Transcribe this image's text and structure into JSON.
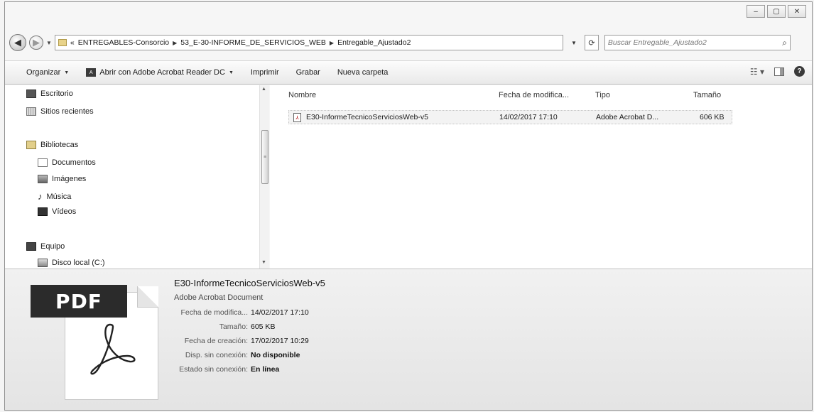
{
  "window": {
    "caption": {
      "minimize_glyph": "–",
      "maximize_glyph": "▢",
      "close_glyph": "✕"
    }
  },
  "address_bar": {
    "overflow": "«",
    "crumbs": [
      "ENTREGABLES-Consorcio",
      "53_E-30-INFORME_DE_SERVICIOS_WEB",
      "Entregable_Ajustado2"
    ],
    "separator": "▶",
    "dropdown": "▼",
    "refresh": "⟳",
    "search_placeholder": "Buscar Entregable_Ajustado2",
    "search_icon": "⌕"
  },
  "toolbar": {
    "organize": "Organizar",
    "open_with": "Abrir con Adobe Acrobat Reader DC",
    "print": "Imprimir",
    "burn": "Grabar",
    "new_folder": "Nueva carpeta",
    "view_icon": "☷",
    "help": "?"
  },
  "nav": {
    "favorites": [
      "Escritorio",
      "Sitios recientes"
    ],
    "libraries": "Bibliotecas",
    "library_items": [
      "Documentos",
      "Imágenes",
      "Música",
      "Vídeos"
    ],
    "computer": "Equipo",
    "computer_items": [
      "Disco local (C:)"
    ]
  },
  "file_list": {
    "columns": {
      "name": "Nombre",
      "modified": "Fecha de modifica...",
      "type": "Tipo",
      "size": "Tamaño"
    },
    "rows": [
      {
        "name": "E30-InformeTecnicoServiciosWeb-v5",
        "modified": "14/02/2017 17:10",
        "type": "Adobe Acrobat D...",
        "size": "606 KB"
      }
    ]
  },
  "details": {
    "thumbnail_label": "PDF",
    "title": "E30-InformeTecnicoServiciosWeb-v5",
    "subtitle": "Adobe Acrobat Document",
    "fields": [
      {
        "label": "Fecha de modifica...",
        "value": "14/02/2017 17:10",
        "bold": false
      },
      {
        "label": "Tamaño:",
        "value": "605 KB",
        "bold": false
      },
      {
        "label": "Fecha de creación:",
        "value": "17/02/2017 10:29",
        "bold": false
      },
      {
        "label": "Disp. sin conexión:",
        "value": "No disponible",
        "bold": true
      },
      {
        "label": "Estado sin conexión:",
        "value": "En línea",
        "bold": true
      }
    ]
  },
  "icons": [
    "back-icon",
    "forward-icon",
    "folder-icon",
    "search-icon",
    "acrobat-icon",
    "pdf-file-icon",
    "desktop-icon",
    "recent-places-icon",
    "library-icon",
    "documents-icon",
    "images-icon",
    "music-icon",
    "videos-icon",
    "computer-icon",
    "disk-icon",
    "help-icon",
    "preview-pane-icon",
    "view-options-icon"
  ]
}
